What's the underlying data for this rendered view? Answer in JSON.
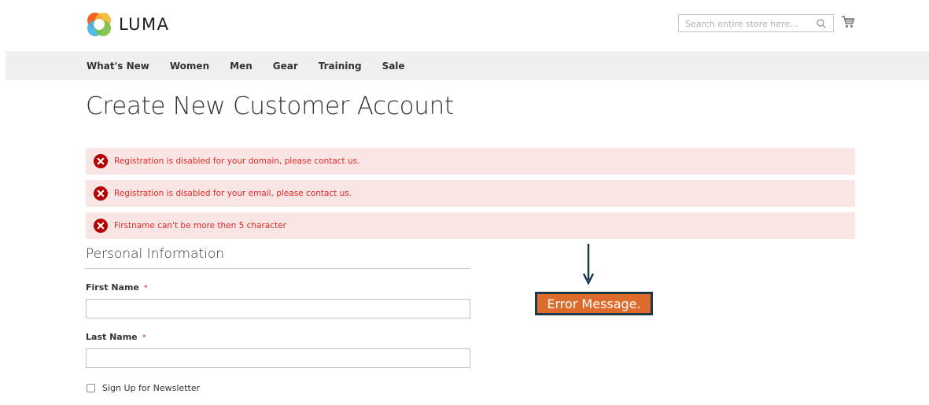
{
  "brand": {
    "name": "LUMA"
  },
  "search": {
    "placeholder": "Search entire store here...",
    "value": ""
  },
  "nav": {
    "items": [
      "What's New",
      "Women",
      "Men",
      "Gear",
      "Training",
      "Sale"
    ]
  },
  "page": {
    "title": "Create New Customer Account"
  },
  "messages": [
    {
      "type": "error",
      "text": "Registration is disabled for your domain, please contact us."
    },
    {
      "type": "error",
      "text": "Registration is disabled for your email, please contact us."
    },
    {
      "type": "error",
      "text": "Firstname can't be more then 5 character"
    }
  ],
  "form": {
    "legend": "Personal Information",
    "first_name": {
      "label": "First Name",
      "required_mark": "*",
      "value": ""
    },
    "last_name": {
      "label": "Last Name",
      "required_mark": "*",
      "value": ""
    },
    "newsletter": {
      "label": "Sign Up for Newsletter",
      "checked": false
    }
  },
  "annotation": {
    "label": "Error Message."
  },
  "colors": {
    "error_bg": "#fae5e5",
    "error_text": "#e02b27",
    "nav_bg": "#f0f0f0",
    "callout_bg": "#dd6b2c",
    "callout_border": "#1d3a4b"
  },
  "icons": {
    "logo": "luma-logo-icon",
    "search": "search-icon",
    "cart": "cart-icon",
    "error": "error-circle-icon",
    "arrow": "arrow-down-icon"
  }
}
